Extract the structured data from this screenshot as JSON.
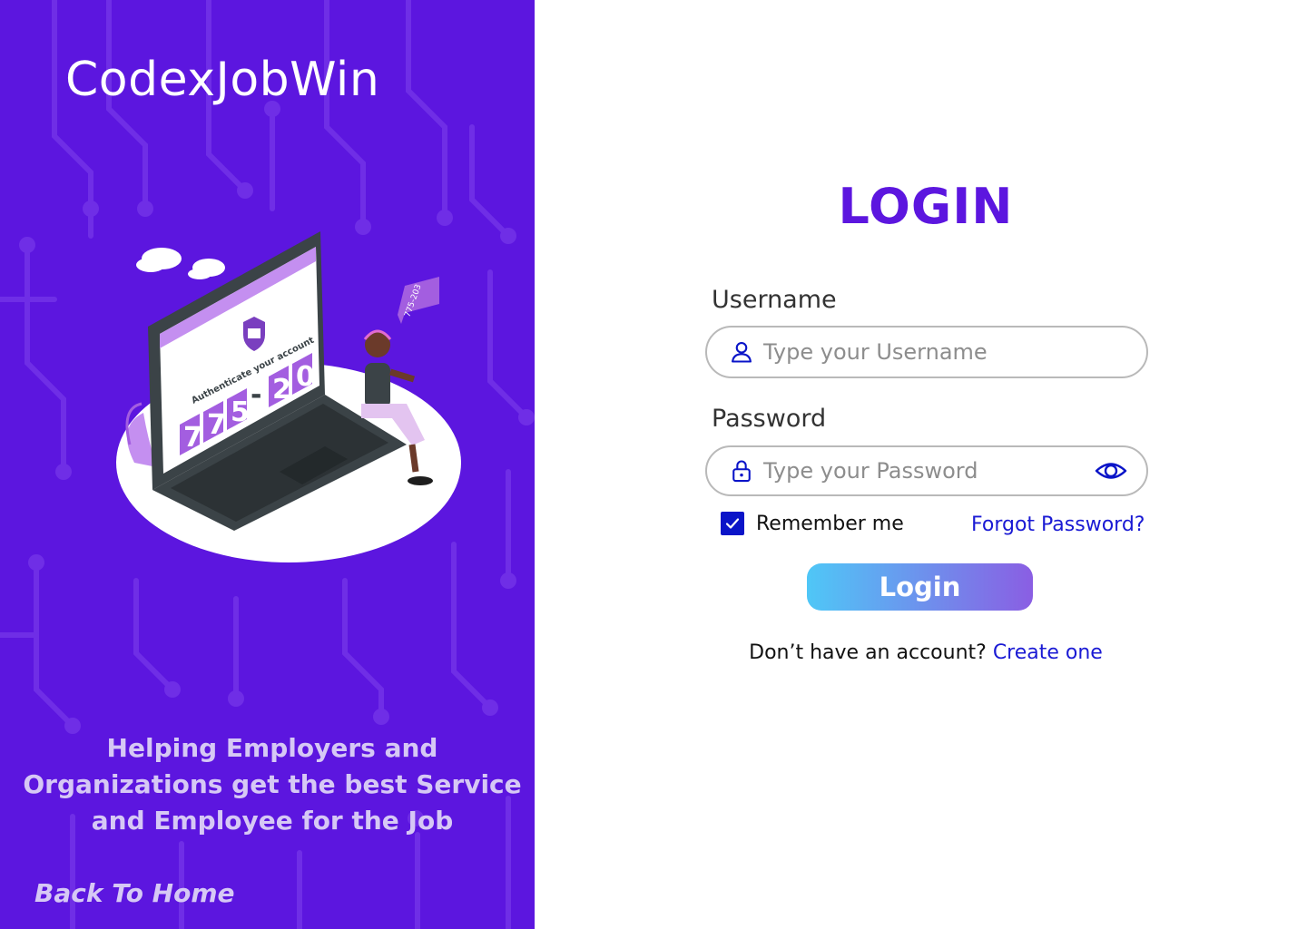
{
  "brand": {
    "name": "CodexJobWin"
  },
  "illustration": {
    "screen_text": "Authenticate your account",
    "code_digits": [
      "7",
      "7",
      "5",
      "-",
      "2",
      "0"
    ],
    "tag_code": "775-203"
  },
  "tagline": "Helping Employers and Organizations get the best Service and Employee for the Job",
  "back_home": "Back To Home",
  "login": {
    "title": "LOGIN",
    "username_label": "Username",
    "username_placeholder": "Type your Username",
    "password_label": "Password",
    "password_placeholder": "Type your Password",
    "remember_label": "Remember me",
    "remember_checked": true,
    "forgot_link": "Forgot Password?",
    "button_label": "Login",
    "signup_prompt": "Don’t have an account?",
    "signup_link": "Create one"
  },
  "icons": {
    "username": "user-icon",
    "password": "lock-icon",
    "show_password": "eye-icon",
    "checkbox": "check-icon"
  },
  "colors": {
    "brand_purple": "#5c16df",
    "link_blue": "#1a1ad4",
    "button_gradient_start": "#4fc7f7",
    "button_gradient_end": "#8a5ee3"
  }
}
